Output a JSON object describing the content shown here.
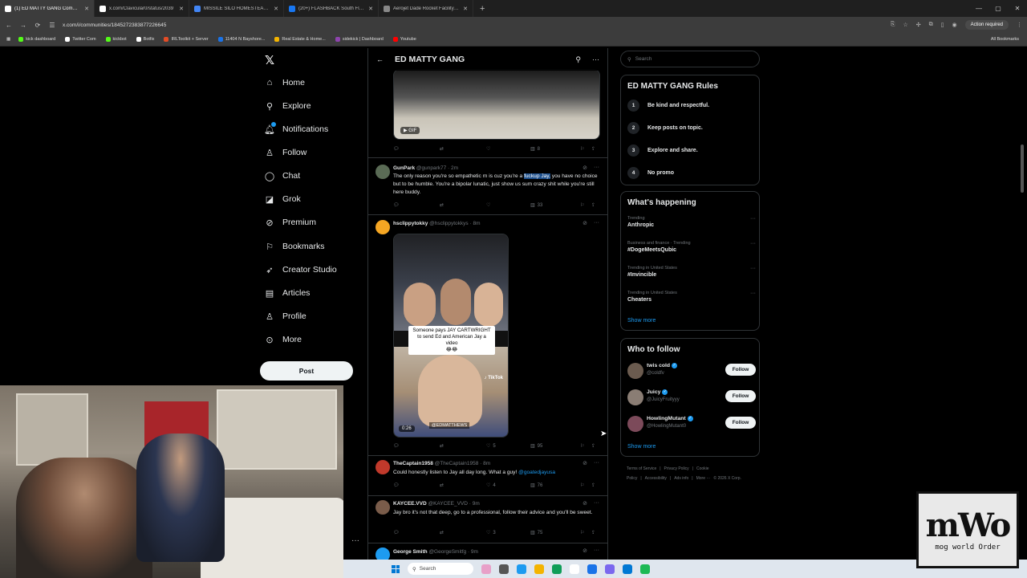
{
  "browser": {
    "tabs": [
      {
        "label": "(1) ED MATTY GANG Commun",
        "color": "#ffffff",
        "active": true
      },
      {
        "label": "x.com/Clavicular0/status/2039",
        "color": "#ffffff"
      },
      {
        "label": "MISSILE SILO HOMESTEAD - G",
        "color": "#4285f4"
      },
      {
        "label": "(20+) FLASHBACK South Florid",
        "color": "#1877f2"
      },
      {
        "label": "Aerojet Dade Rocket Facility | A",
        "color": "#888888"
      }
    ],
    "url": "x.com/i/communities/1845272383877226645",
    "action_required": "Action required",
    "bookmarks": [
      {
        "label": "kick dashboard",
        "color": "#53fc18"
      },
      {
        "label": "Twitter Com",
        "color": "#ffffff"
      },
      {
        "label": "kickbot",
        "color": "#53fc18"
      },
      {
        "label": "Botfix",
        "color": "#ffffff"
      },
      {
        "label": "IRLToolkit + Server",
        "color": "#e34c26"
      },
      {
        "label": "11404 N Bayshore...",
        "color": "#1a73e8"
      },
      {
        "label": "Real Estate & Home...",
        "color": "#f4b400"
      },
      {
        "label": "sidekick | Dashboard",
        "color": "#8e44ad"
      },
      {
        "label": "Youtube",
        "color": "#ff0000"
      }
    ],
    "all_bookmarks": "All Bookmarks"
  },
  "nav": {
    "items": [
      {
        "label": "Home",
        "icon": "home-icon",
        "glyph": "⌂"
      },
      {
        "label": "Explore",
        "icon": "search-icon",
        "glyph": "⚲"
      },
      {
        "label": "Notifications",
        "icon": "bell-icon",
        "glyph": "🔔︎"
      },
      {
        "label": "Follow",
        "icon": "person-plus-icon",
        "glyph": "♙"
      },
      {
        "label": "Chat",
        "icon": "chat-icon",
        "glyph": "◯"
      },
      {
        "label": "Grok",
        "icon": "grok-icon",
        "glyph": "◪"
      },
      {
        "label": "Premium",
        "icon": "premium-icon",
        "glyph": "⊘"
      },
      {
        "label": "Bookmarks",
        "icon": "bookmark-icon",
        "glyph": "⚐"
      },
      {
        "label": "Creator Studio",
        "icon": "rocket-icon",
        "glyph": "➶"
      },
      {
        "label": "Articles",
        "icon": "article-icon",
        "glyph": "▤"
      },
      {
        "label": "Profile",
        "icon": "profile-icon",
        "glyph": "♙"
      },
      {
        "label": "More",
        "icon": "more-icon",
        "glyph": "⊙"
      }
    ],
    "post_label": "Post"
  },
  "community": {
    "title": "ED MATTY GANG",
    "gif_badge": "GIF",
    "gif_actions": {
      "views": "8"
    },
    "tweets": [
      {
        "name": "GunPark",
        "handle": "@gunpark77 · 2m",
        "text_before": "The only reason you're so empathetic rn is cuz you're a ",
        "text_highlight": "fuckup Jay,",
        "text_after": " you have no choice but to be humble. You're a bipolar lunatic, just show us sum crazy shit while you're still here buddy.",
        "views": "33",
        "avatar_color": "#5a6b55"
      },
      {
        "name": "hsclippytokky",
        "handle": "@hsclippytokkys · 8m",
        "video_caption": "Someone pays JAY CARTWRIGHT to send Ed and American Jay a video",
        "video_emoji": "😂😂",
        "video_brand": "TikTok",
        "video_handle": "@EDMATTHEWS",
        "video_duration": "0:26",
        "likes": "5",
        "views": "95",
        "avatar_color": "#f5a623"
      },
      {
        "name": "TheCaptain1958",
        "handle": "@TheCaptain1958 · 8m",
        "text": "Could honestly listen to Jay all day long. What a guy! ",
        "mention": "@goatedjayusa",
        "likes": "4",
        "views": "76",
        "avatar_color": "#c0392b"
      },
      {
        "name": "KAYCEE.VVD",
        "handle": "@KAYCEE_VVD · 9m",
        "text": "Jay bro it's not that deep, go to a professional, follow their advice and you'll be sweet.",
        "likes": "3",
        "views": "75",
        "avatar_color": "#7a5c4a"
      },
      {
        "name": "George Smith",
        "handle": "@GeorgeSmitfg · 9m",
        "avatar_color": "#1d9bf0"
      }
    ]
  },
  "sidebar": {
    "search_placeholder": "Search",
    "rules_title": "ED MATTY GANG Rules",
    "rules": [
      {
        "num": "1",
        "text": "Be kind and respectful."
      },
      {
        "num": "2",
        "text": "Keep posts on topic."
      },
      {
        "num": "3",
        "text": "Explore and share."
      },
      {
        "num": "4",
        "text": "No promo"
      }
    ],
    "happening_title": "What's happening",
    "trends": [
      {
        "context": "Trending",
        "title": "Anthropic"
      },
      {
        "context": "Business and finance · Trending",
        "title": "#DogeMeetsQubic"
      },
      {
        "context": "Trending in United States",
        "title": "#Invincible"
      },
      {
        "context": "Trending in United States",
        "title": "Cheaters"
      }
    ],
    "show_more": "Show more",
    "wtf_title": "Who to follow",
    "who_to_follow": [
      {
        "name": "twis cold",
        "handle": "@coldfv",
        "color": "#6b5b4f"
      },
      {
        "name": "Juicy",
        "handle": "@JuicyFruityyy",
        "color": "#8a7d74"
      },
      {
        "name": "HowlingMutant",
        "handle": "@HowlingMutant0",
        "color": "#7c4a5a"
      }
    ],
    "follow_label": "Follow",
    "footer": [
      "Terms of Service",
      "|",
      "Privacy Policy",
      "|",
      "Cookie Policy",
      "|",
      "Accessibility",
      "|",
      "Ads info",
      "|",
      "More ···",
      "© 2026 X Corp."
    ]
  },
  "taskbar": {
    "search_label": "Search",
    "apps": [
      "#e8a0c8",
      "#555555",
      "#1d9bf0",
      "#f4b400",
      "#0f9d58",
      "#ffffff",
      "#1a73e8",
      "#7b68ee",
      "#0078d4",
      "#1db954"
    ]
  },
  "overlay": {
    "logo_big": "mWo",
    "logo_small": "mog world Order"
  }
}
